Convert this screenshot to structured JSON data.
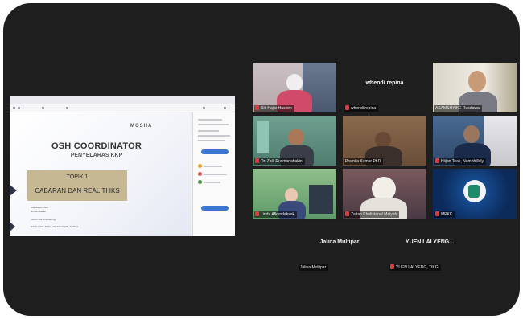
{
  "share": {
    "logo": "MOSHA",
    "slide_title": "OSH COORDINATOR",
    "slide_subtitle": "PENYELARAS KKP",
    "topic_label": "TOPIK 1",
    "topic_name": "CABARAN DAN REALITI IKS",
    "small_lines": [
      "Disediakan Oleh",
      "NIOSH Sabah",
      "INSINYUR Engineering",
      "NIOSH, MALAYSIA, KK SARAWAK, SABAH"
    ]
  },
  "participants": [
    {
      "name": "Siti Hajar Hashim",
      "muted": true,
      "video": true
    },
    {
      "name": "whendi repina",
      "muted": true,
      "video": false,
      "display": "whendi repina"
    },
    {
      "name": "ASAMSHYIKE Rusdawa",
      "muted": false,
      "video": true,
      "active": true
    },
    {
      "name": "Dr. Zaili Rusmanahakin",
      "muted": true,
      "video": true
    },
    {
      "name": "Pramila Kumar PhD",
      "muted": false,
      "video": true
    },
    {
      "name": "Hiijan Teak, Nambhillaly",
      "muted": true,
      "video": true
    },
    {
      "name": "Linda Afkundaksak",
      "muted": true,
      "video": true
    },
    {
      "name": "Zaitah Kholistanal Maiyah",
      "muted": true,
      "video": true
    },
    {
      "name": "MPKK",
      "muted": true,
      "video": true
    },
    {
      "name": "Jalina Multipar",
      "muted": false,
      "video": false,
      "display": "Jalina Multipar"
    },
    {
      "name": "YUEN LAI YENG, TIKG",
      "muted": true,
      "video": false,
      "display": "YUEN LAI YENG..."
    }
  ]
}
